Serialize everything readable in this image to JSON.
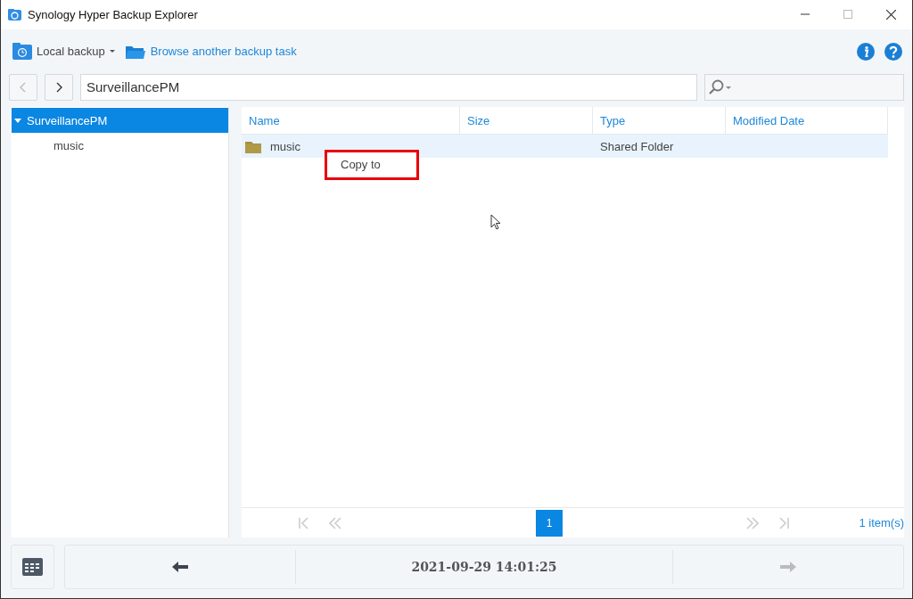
{
  "window": {
    "title": "Synology Hyper Backup Explorer"
  },
  "toolbar": {
    "backup_menu": "Local backup",
    "browse_link": "Browse another backup task"
  },
  "navigation": {
    "back_disabled": true,
    "forward_disabled": false,
    "path": "SurveillancePM"
  },
  "tree": [
    {
      "label": "SurveillancePM",
      "selected": true,
      "expanded": true,
      "children": [
        {
          "label": "music",
          "selected": false
        }
      ]
    }
  ],
  "table": {
    "columns": [
      "Name",
      "Size",
      "Type",
      "Modified Date"
    ],
    "rows": [
      {
        "name": "music",
        "type": "Shared Folder",
        "selected": true
      }
    ]
  },
  "context_menu": {
    "items": [
      "Copy to"
    ]
  },
  "pager": {
    "pages": [
      {
        "label": "1",
        "selected": true
      }
    ],
    "count": "1 item(s)"
  },
  "timeline": {
    "date": "2021-09-29 14:01:25",
    "previous_disabled": false,
    "next_disabled": true
  }
}
